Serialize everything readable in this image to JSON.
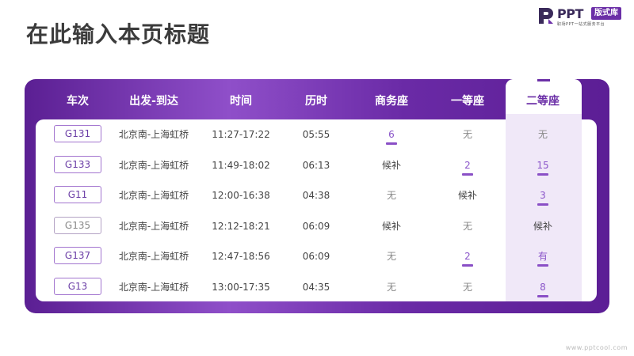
{
  "page": {
    "title": "在此输入本页标题"
  },
  "logo": {
    "ppt": "PPT",
    "badge": "版式库",
    "sub": "职场PPT一站式服务平台"
  },
  "table": {
    "headers": [
      "车次",
      "出发-到达",
      "时间",
      "历时",
      "商务座",
      "一等座",
      "二等座"
    ],
    "rows": [
      {
        "train": "G131",
        "route": "北京南-上海虹桥",
        "time": "11:27-17:22",
        "duration": "05:55",
        "business": "6",
        "first": "无",
        "second": "无"
      },
      {
        "train": "G133",
        "route": "北京南-上海虹桥",
        "time": "11:49-18:02",
        "duration": "06:13",
        "business": "候补",
        "first": "2",
        "second": "15"
      },
      {
        "train": "G11",
        "route": "北京南-上海虹桥",
        "time": "12:00-16:38",
        "duration": "04:38",
        "business": "无",
        "first": "候补",
        "second": "3"
      },
      {
        "train": "G135",
        "route": "北京南-上海虹桥",
        "time": "12:12-18:21",
        "duration": "06:09",
        "business": "候补",
        "first": "无",
        "second": "候补"
      },
      {
        "train": "G137",
        "route": "北京南-上海虹桥",
        "time": "12:47-18:56",
        "duration": "06:09",
        "business": "无",
        "first": "2",
        "second": "有"
      },
      {
        "train": "G13",
        "route": "北京南-上海虹桥",
        "time": "13:00-17:35",
        "duration": "04:35",
        "business": "无",
        "first": "无",
        "second": "8"
      }
    ]
  },
  "watermark": "www.pptcool.com",
  "colors": {
    "accent": "#6b2fa7",
    "panel_light": "#8f4fc9",
    "highlight_col": "#f0e8f8"
  }
}
